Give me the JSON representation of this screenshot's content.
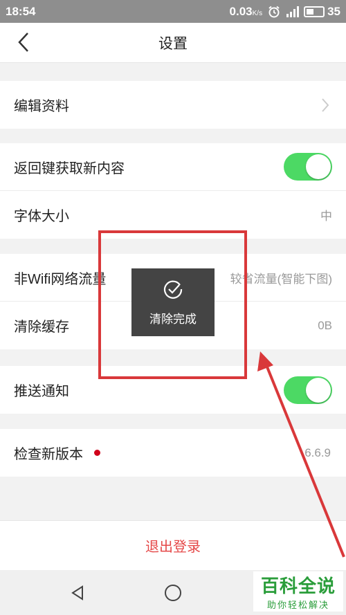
{
  "status_bar": {
    "time": "18:54",
    "speed": "0.03",
    "speed_unit": "K/s",
    "battery": "35",
    "icons": [
      "alarm-icon",
      "signal-icon",
      "battery-icon"
    ]
  },
  "header": {
    "title": "设置",
    "back_icon": "chevron-left-icon"
  },
  "groups": [
    {
      "rows": [
        {
          "label": "编辑资料",
          "accessory": "chevron"
        }
      ]
    },
    {
      "rows": [
        {
          "label": "返回键获取新内容",
          "accessory": "toggle",
          "on": true
        },
        {
          "label": "字体大小",
          "value": "中"
        }
      ]
    },
    {
      "rows": [
        {
          "label": "非Wifi网络流量",
          "value": "较省流量(智能下图)"
        },
        {
          "label": "清除缓存",
          "value": "0B"
        }
      ]
    },
    {
      "rows": [
        {
          "label": "推送通知",
          "accessory": "toggle",
          "on": true
        }
      ]
    },
    {
      "rows": [
        {
          "label": "检查新版本",
          "value": "6.6.9",
          "badge": "red-dot"
        }
      ]
    }
  ],
  "logout_label": "退出登录",
  "toast": {
    "icon": "check-circle-icon",
    "text": "清除完成"
  },
  "system_nav": {
    "icons": [
      "back-triangle-icon",
      "home-circle-icon"
    ]
  },
  "watermark": {
    "title": "百科全说",
    "subtitle": "助你轻松解决"
  },
  "colors": {
    "accent": "#e54848",
    "toggle_on": "#4cd964",
    "annotation": "#d9383a",
    "watermark": "#2a9d3a"
  }
}
